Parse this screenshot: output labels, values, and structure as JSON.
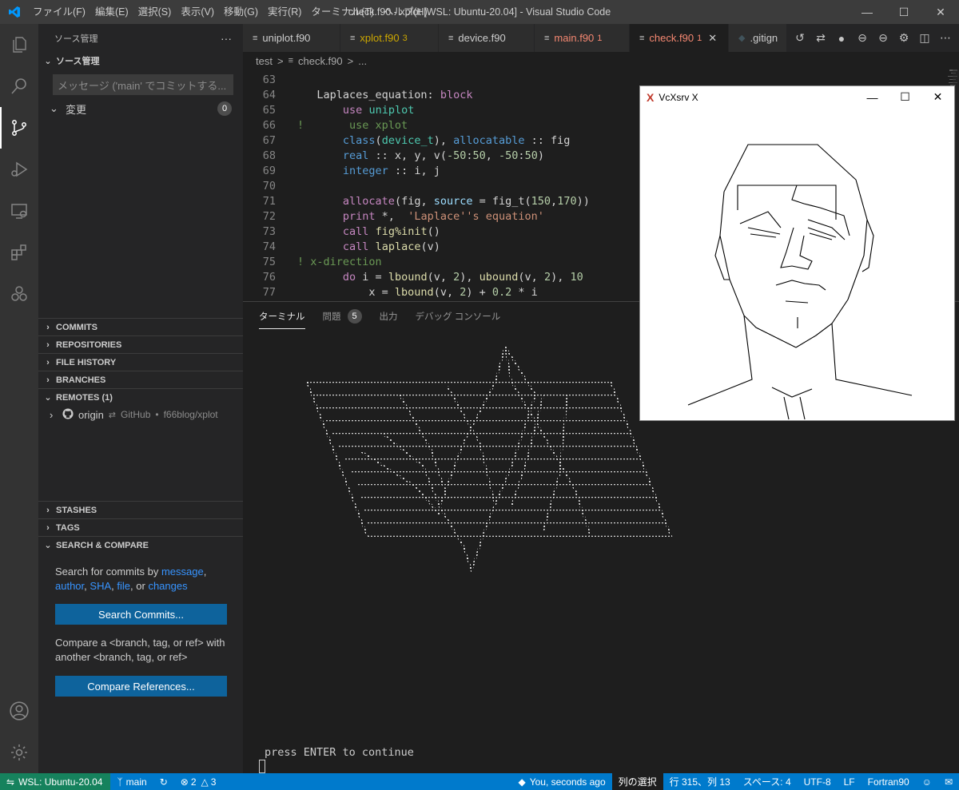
{
  "window": {
    "title": "check.f90 - xplot [WSL: Ubuntu-20.04] - Visual Studio Code",
    "menu": [
      "ファイル(F)",
      "編集(E)",
      "選択(S)",
      "表示(V)",
      "移動(G)",
      "実行(R)",
      "ターミナル(T)",
      "ヘルプ(H)"
    ]
  },
  "sidebar": {
    "title": "ソース管理",
    "more": "···",
    "scm_header": "ソース管理",
    "commit_placeholder": "メッセージ ('main' でコミットする...",
    "changes_label": "変更",
    "changes_count": "0",
    "sections": {
      "commits": "COMMITS",
      "repositories": "REPOSITORIES",
      "file_history": "FILE HISTORY",
      "branches": "BRANCHES",
      "remotes": "REMOTES (1)",
      "stashes": "STASHES",
      "tags": "TAGS",
      "search_compare": "SEARCH & COMPARE"
    },
    "remote": {
      "name": "origin",
      "arrow": "⇄",
      "provider": "GitHub",
      "sep": "•",
      "repo": "f66blog/xplot"
    },
    "search_text_pre": "Search for commits by ",
    "search_link_message": "message",
    "search_comma1": ",",
    "search_link_author": "author",
    "search_comma2": ",",
    "search_link_sha": "SHA",
    "search_comma3": ",",
    "search_link_file": "file",
    "search_or": ", or",
    "search_link_changes": "changes",
    "search_button": "Search Commits...",
    "compare_text": "Compare a <branch, tag, or ref> with another <branch, tag, or ref>",
    "compare_button": "Compare References..."
  },
  "tabs": [
    {
      "name": "uniplot.f90",
      "status": ""
    },
    {
      "name": "xplot.f90",
      "status": "3"
    },
    {
      "name": "device.f90",
      "status": ""
    },
    {
      "name": "main.f90",
      "status": "1"
    },
    {
      "name": "check.f90",
      "status": "1"
    },
    {
      "name": ".gitign",
      "status": ""
    }
  ],
  "breadcrumb": [
    "test",
    ">",
    "check.f90",
    ">",
    "..."
  ],
  "code": {
    "line_numbers": [
      "63",
      "64",
      "65",
      "66",
      "67",
      "68",
      "69",
      "70",
      "71",
      "72",
      "73",
      "74",
      "75",
      "76",
      "77"
    ]
  },
  "panel": {
    "tabs": [
      "ターミナル",
      "問題",
      "出力",
      "デバッグ コンソール"
    ],
    "problems_count": "5",
    "terminal_prompt": "press ENTER to continue"
  },
  "xwindow": {
    "title": "VcXsrv X"
  },
  "statusbar": {
    "remote": "WSL: Ubuntu-20.04",
    "branch": "main",
    "errors": "2",
    "warnings": "3",
    "blame": "You, seconds ago",
    "selection_mode": "列の選択",
    "position": "行 315、列 13",
    "spaces": "スペース: 4",
    "encoding": "UTF-8",
    "eol": "LF",
    "language": "Fortran90"
  },
  "colors": {
    "accent": "#007acc",
    "remote": "#16825d",
    "error_tab": "#f48771",
    "warning_tab": "#cca700"
  }
}
